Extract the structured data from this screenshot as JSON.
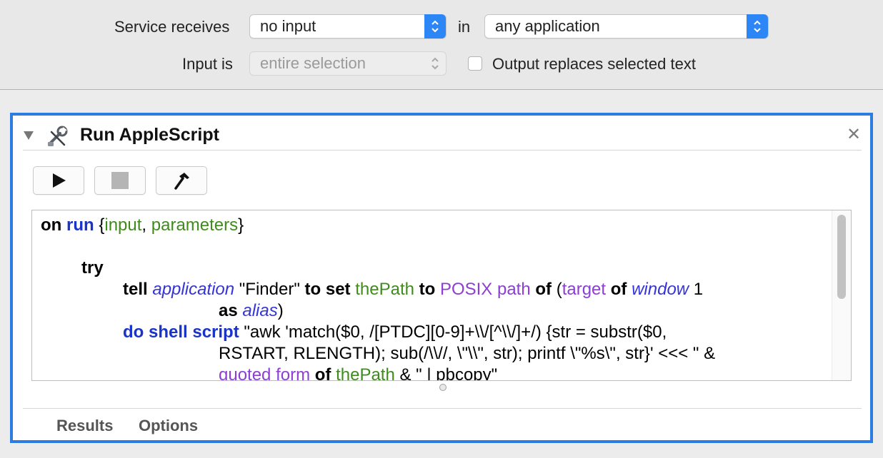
{
  "settings": {
    "service_receives_label": "Service receives",
    "input_type_value": "no input",
    "in_label": "in",
    "application_value": "any application",
    "input_is_label": "Input is",
    "input_is_value": "entire selection",
    "output_replaces_label": "Output replaces selected text",
    "output_replaces_checked": false
  },
  "action": {
    "title": "Run AppleScript",
    "icon": "applescript-wrench-icon",
    "toolbar": [
      "run-icon",
      "stop-icon",
      "compile-hammer-icon"
    ]
  },
  "code": {
    "line1": {
      "t1": "on",
      "t2": "run",
      "t3": "{",
      "t4": "input",
      "t5": ", ",
      "t6": "parameters",
      "t7": "}"
    },
    "line3": {
      "t1": "try"
    },
    "line4": {
      "t1": "tell",
      "t2": "application",
      "t3": "\"Finder\"",
      "t4": "to",
      "t5": "set",
      "t6": "thePath",
      "t7": "to",
      "t8": "POSIX path",
      "t9": "of",
      "t10": "(",
      "t11": "target",
      "t12": "of",
      "t13": "window",
      "t14": "1"
    },
    "line5": {
      "t1": "as",
      "t2": "alias",
      "t3": ")"
    },
    "line6": {
      "t1": "do shell script",
      "t2": "\"awk 'match($0, /[PTDC][0-9]+\\\\/[^\\\\/]+/) {str = substr($0,"
    },
    "line7": {
      "t1": "RSTART, RLENGTH); sub(/\\\\//, \\\"\\\\\", str); printf \\\"%s\\\", str}' <<< \" &"
    },
    "line8": {
      "t1": "quoted form",
      "t2": "of",
      "t3": "thePath",
      "t4": "& \" | pbcopy\""
    }
  },
  "tabs": {
    "results": "Results",
    "options": "Options"
  },
  "colors": {
    "accent": "#2d7de0",
    "keyword": "#000000",
    "command": "#1a33c9",
    "variable": "#3f8c1d",
    "application": "#3434d8",
    "property": "#8c3ed6"
  }
}
